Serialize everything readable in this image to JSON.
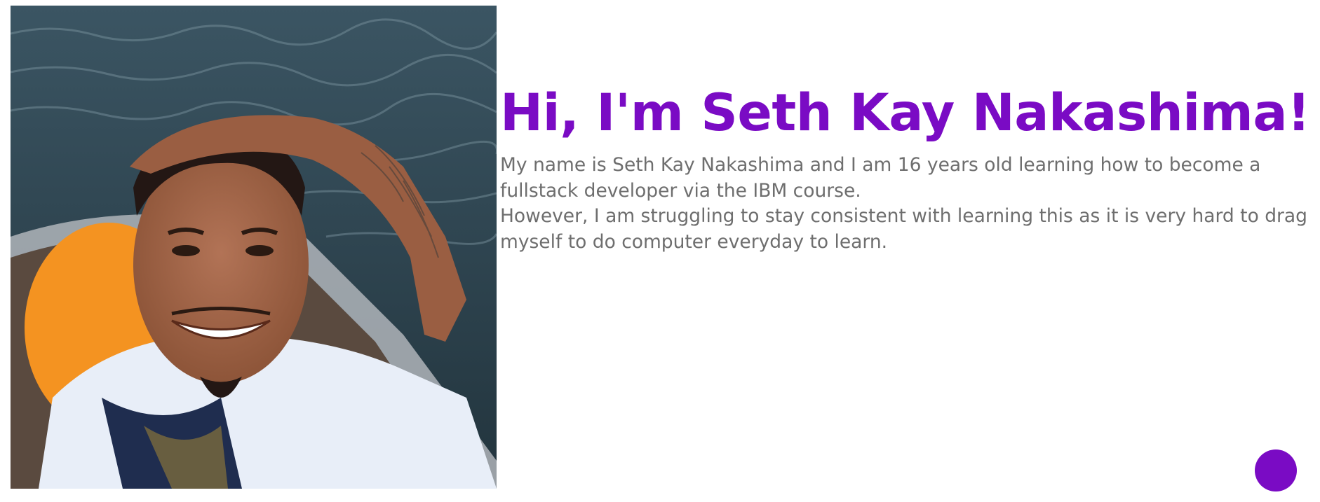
{
  "profile": {
    "photo_alt": "photo-of-seth-kay-nakashima"
  },
  "intro": {
    "heading": "Hi, I'm Seth Kay Nakashima!",
    "paragraph_1": "My name is Seth Kay Nakashima and I am 16 years old learning how to become a fullstack developer via the IBM course.",
    "paragraph_2": "However, I am struggling to stay consistent with learning this as it is very hard to drag myself to do computer everyday to learn."
  },
  "icons": {
    "heading_image": "broken-image-icon"
  },
  "colors": {
    "accent": "#7a0bc4",
    "body_text": "#6e6e6e",
    "background": "#ffffff"
  }
}
